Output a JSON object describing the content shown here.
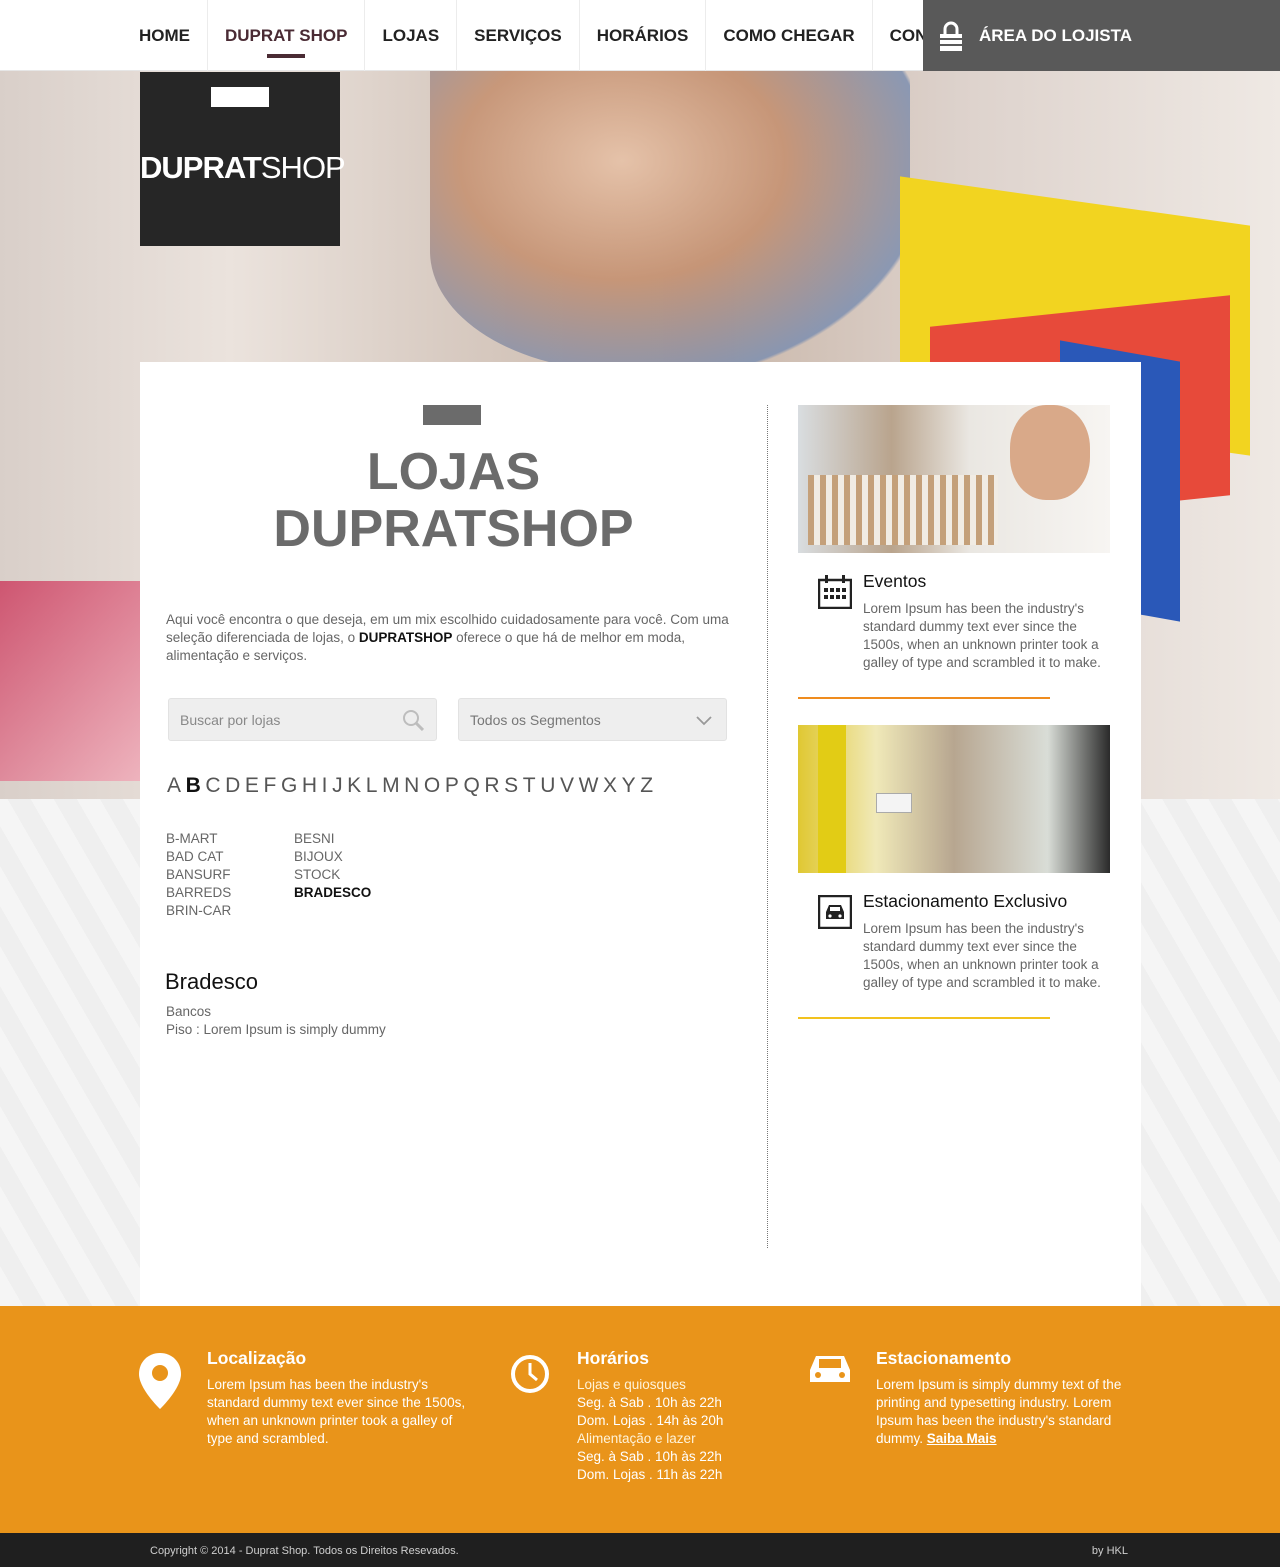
{
  "nav": {
    "items": [
      {
        "label": "HOME"
      },
      {
        "label": "DUPRAT SHOP"
      },
      {
        "label": "LOJAS"
      },
      {
        "label": "SERVIÇOS"
      },
      {
        "label": "HORÁRIOS"
      },
      {
        "label": "COMO CHEGAR"
      },
      {
        "label": "CONTATO"
      }
    ],
    "active_index": 1,
    "lojista_label": "ÁREA DO LOJISTA"
  },
  "logo": {
    "brand_bold": "DUPRAT",
    "brand_light": "SHOP"
  },
  "main": {
    "title_line1": "LOJAS",
    "title_line2": "DUPRATSHOP",
    "intro_before": "Aqui você encontra o que deseja, em um mix escolhido cuidadosamente para você. Com uma seleção diferenciada de lojas, o ",
    "intro_bold": "DUPRATSHOP",
    "intro_after": " oferece o que há de melhor em moda, alimentação e serviços.",
    "search_placeholder": "Buscar por lojas",
    "segment_selected": "Todos os Segmentos",
    "alphabet": [
      "A",
      "B",
      "C",
      "D",
      "E",
      "F",
      "G",
      "H",
      "I",
      "J",
      "K",
      "L",
      "M",
      "N",
      "O",
      "P",
      "Q",
      "R",
      "S",
      "T",
      "U",
      "V",
      "W",
      "X",
      "Y",
      "Z"
    ],
    "active_letter": "B",
    "stores_col1": [
      "B-MART",
      "BAD CAT",
      "BANSURF",
      "BARREDS",
      "BRIN-CAR"
    ],
    "stores_col2": [
      "BESNI",
      "BIJOUX",
      "STOCK",
      "BRADESCO"
    ],
    "active_store": "BRADESCO",
    "detail": {
      "name": "Bradesco",
      "segment": "Bancos",
      "floor": "Piso : Lorem Ipsum is simply dummy"
    }
  },
  "side": {
    "cards": [
      {
        "title": "Eventos",
        "text": "Lorem Ipsum has been the industry's standard dummy text ever since the 1500s, when an unknown printer took a galley of type and scrambled it to make.",
        "icon": "calendar-icon",
        "line_color": "#ef8c1e"
      },
      {
        "title": "Estacionamento Exclusivo",
        "text": "Lorem Ipsum has been the industry's standard dummy text ever since the 1500s, when an unknown printer took a galley of type and scrambled it to make.",
        "icon": "car-icon",
        "line_color": "#f2c21e"
      }
    ]
  },
  "footer": {
    "localizacao": {
      "title": "Localização",
      "text": "Lorem Ipsum has been the industry's standard dummy text ever since the 1500s, when an unknown printer took a galley of type and scrambled."
    },
    "horarios": {
      "title": "Horários",
      "head1": "Lojas e quiosques",
      "line1": "Seg. à Sab . 10h às 22h",
      "line2": "Dom. Lojas . 14h às 20h",
      "head2": "Alimentação e lazer",
      "line3": "Seg. à Sab . 10h às 22h",
      "line4": "Dom. Lojas . 11h às 22h"
    },
    "estacionamento": {
      "title": "Estacionamento",
      "text": "Lorem Ipsum is simply dummy text of the printing and typesetting industry. Lorem Ipsum has been the industry's standard dummy. ",
      "link": "Saiba Mais"
    },
    "copyright": "Copyright © 2014 - Duprat Shop. Todos os Direitos Resevados.",
    "credit": "by HKL"
  },
  "colors": {
    "footer_bg": "#e9941a",
    "nav_active": "#4a2b34",
    "lojista_bg": "#595959"
  }
}
